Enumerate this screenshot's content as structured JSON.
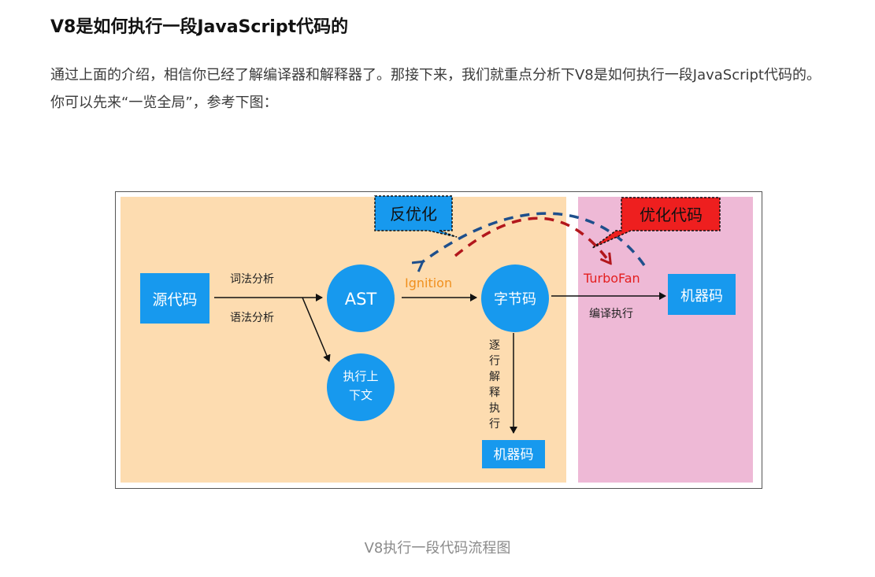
{
  "article": {
    "title": "V8是如何执行一段JavaScript代码的",
    "paragraph": "通过上面的介绍，相信你已经了解编译器和解释器了。那接下来，我们就重点分析下V8是如何执行一段JavaScript代码的。你可以先来“一览全局”，参考下图：",
    "caption": "V8执行一段代码流程图"
  },
  "diagram": {
    "nodes": {
      "source": "源代码",
      "ast": "AST",
      "bytecode": "字节码",
      "context": "执行上下文",
      "machine_code_bottom": "机器码",
      "machine_code_right": "机器码"
    },
    "labels": {
      "lexical": "词法分析",
      "syntax": "语法分析",
      "ignition": "Ignition",
      "turbofan": "TurboFan",
      "compile_exec": "编译执行",
      "interpret_exec": "逐行解释执行"
    },
    "callouts": {
      "deopt": "反优化",
      "optimize": "优化代码"
    },
    "colors": {
      "left_panel": "#fddcb0",
      "right_panel": "#eeb9d6",
      "node_blue": "#1799ee",
      "ignition_orange": "#f0901e",
      "turbofan_red": "#e41f1f",
      "deopt_arrow": "#1e4f8c",
      "optimize_arrow": "#b2171c",
      "optimize_callout": "#ee1f1f"
    }
  }
}
